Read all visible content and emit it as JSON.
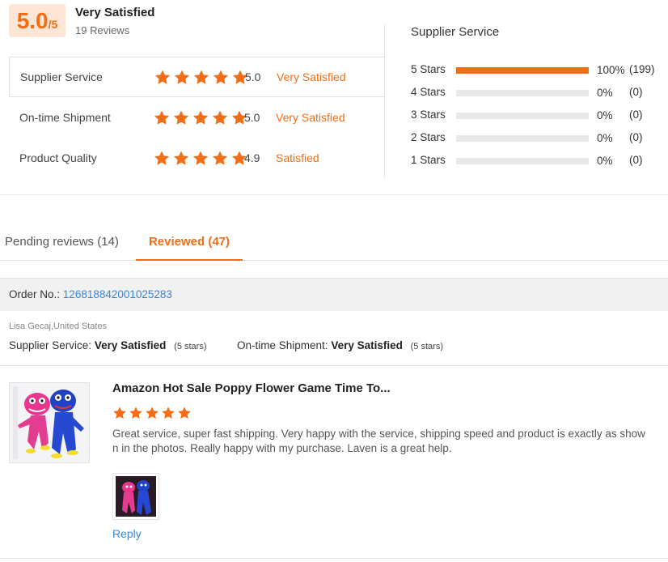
{
  "summary": {
    "score": "5.0",
    "score_max": "/5",
    "label": "Very Satisfied",
    "review_count": "19 Reviews"
  },
  "ratings": [
    {
      "label": "Supplier Service",
      "value": "5.0",
      "text": "Very Satisfied",
      "stars": 5
    },
    {
      "label": "On-time Shipment",
      "value": "5.0",
      "text": "Very Satisfied",
      "stars": 5
    },
    {
      "label": "Product Quality",
      "value": "4.9",
      "text": "Satisfied",
      "stars": 5
    }
  ],
  "distribution": {
    "title": "Supplier Service",
    "rows": [
      {
        "label": "5  Stars",
        "fill": 1.0,
        "percent": "100%",
        "count": "(199)"
      },
      {
        "label": "4  Stars",
        "fill": 0,
        "percent": "0%",
        "count": "(0)"
      },
      {
        "label": "3  Stars",
        "fill": 0,
        "percent": "0%",
        "count": "(0)"
      },
      {
        "label": "2  Stars",
        "fill": 0,
        "percent": "0%",
        "count": "(0)"
      },
      {
        "label": "1  Stars",
        "fill": 0,
        "percent": "0%",
        "count": "(0)"
      }
    ]
  },
  "tabs": {
    "pending": "Pending reviews (14)",
    "reviewed": "Reviewed (47)"
  },
  "order": {
    "label": "Order No.:",
    "number": "126818842001025283"
  },
  "review": {
    "reviewer": "Lisa Gecaj,United States",
    "supplier_label": "Supplier Service:",
    "supplier_value": "Very Satisfied",
    "supplier_stars": "(5 stars)",
    "shipment_label": "On-time Shipment:",
    "shipment_value": "Very Satisfied",
    "shipment_stars": "(5 stars)",
    "product_title": "Amazon Hot Sale Poppy Flower Game Time To...",
    "stars": 5,
    "text": "Great service, super fast shipping. Very happy with the service, shipping speed and product is exactly as shown in the photos. Really happy with my purchase. Laven is a great help.",
    "reply_label": "Reply"
  },
  "colors": {
    "accent": "#f36d16",
    "link": "#3a86d4"
  }
}
